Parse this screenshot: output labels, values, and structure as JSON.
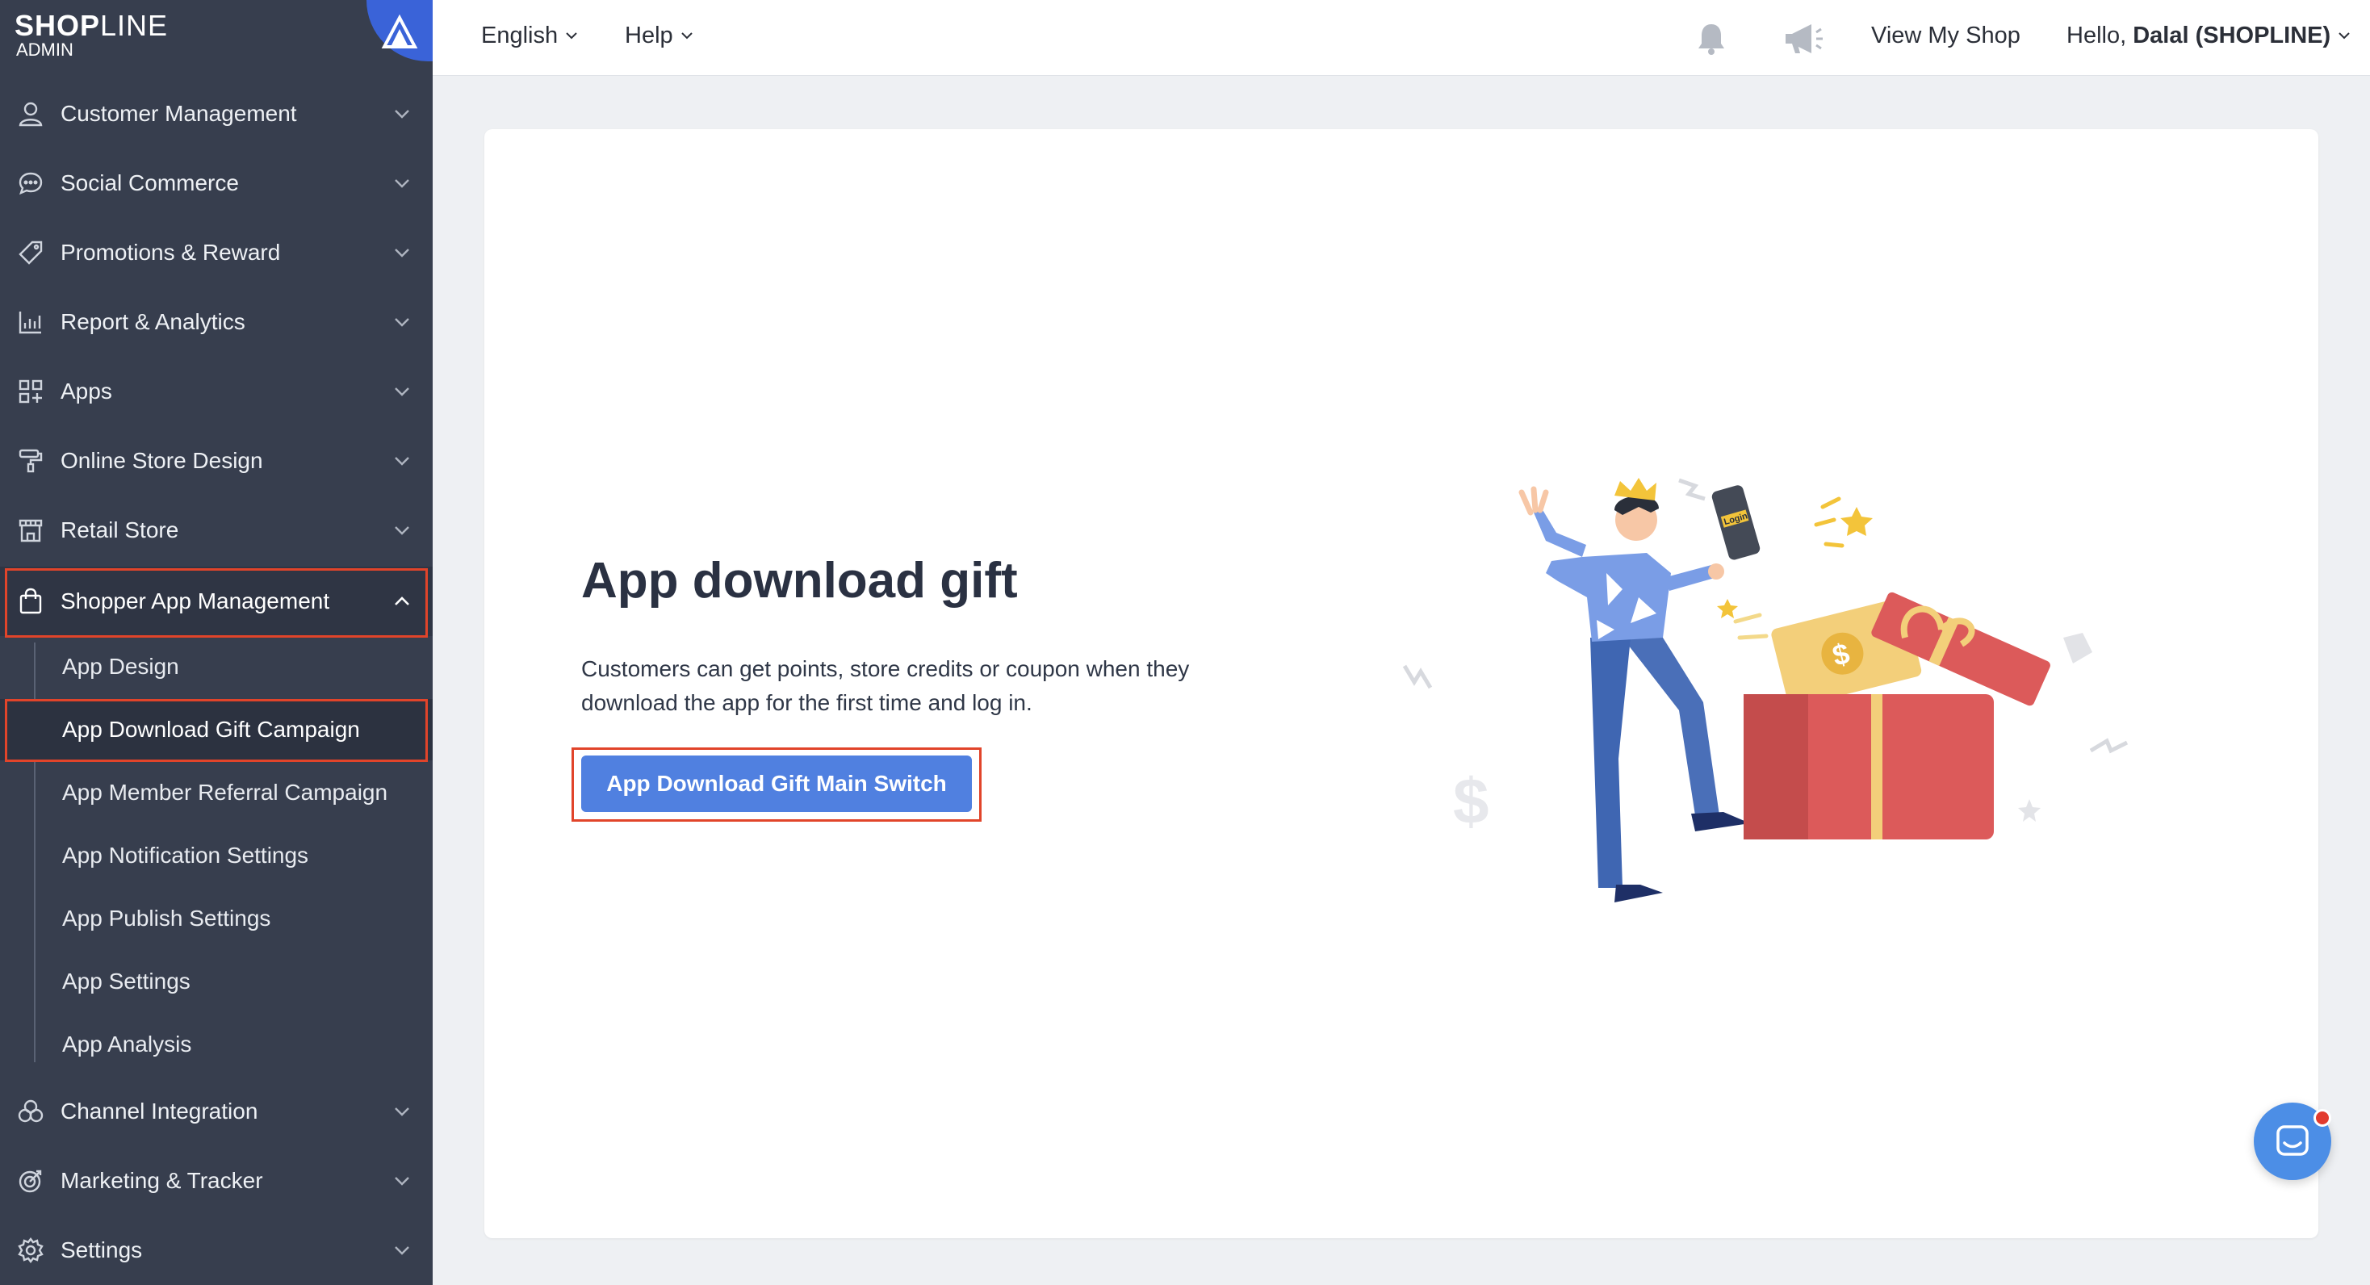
{
  "brand": {
    "logo_main": "SHOP",
    "logo_thin": "LINE",
    "logo_sub": "ADMIN"
  },
  "colors": {
    "sidebar": "#373e4e",
    "accent": "#5080e0",
    "highlight": "#e1442a"
  },
  "sidebar": {
    "items": [
      {
        "label": "Customer Management",
        "icon": "person-icon"
      },
      {
        "label": "Social Commerce",
        "icon": "chat-bubble-icon"
      },
      {
        "label": "Promotions & Reward",
        "icon": "tag-icon"
      },
      {
        "label": "Report & Analytics",
        "icon": "bar-chart-icon"
      },
      {
        "label": "Apps",
        "icon": "apps-grid-icon"
      },
      {
        "label": "Online Store Design",
        "icon": "paint-roller-icon"
      },
      {
        "label": "Retail Store",
        "icon": "storefront-icon"
      },
      {
        "label": "Shopper App Management",
        "icon": "shopping-bag-icon",
        "expanded": true
      },
      {
        "label": "Channel Integration",
        "icon": "channels-icon"
      },
      {
        "label": "Marketing & Tracker",
        "icon": "target-icon"
      },
      {
        "label": "Settings",
        "icon": "gear-icon"
      }
    ],
    "submenu": [
      {
        "label": "App Design"
      },
      {
        "label": "App Download Gift Campaign",
        "current": true
      },
      {
        "label": "App Member Referral Campaign"
      },
      {
        "label": "App Notification Settings"
      },
      {
        "label": "App Publish Settings"
      },
      {
        "label": "App Settings"
      },
      {
        "label": "App Analysis"
      }
    ]
  },
  "topbar": {
    "language": "English",
    "help": "Help",
    "view_shop": "View My Shop",
    "hello_prefix": "Hello,",
    "user": "Dalal (SHOPLINE)"
  },
  "main": {
    "title": "App download gift",
    "description": "Customers can get points, store credits or coupon when they download the app for the first time and log in.",
    "button_label": "App Download Gift Main Switch",
    "illustration_text": "Login"
  }
}
